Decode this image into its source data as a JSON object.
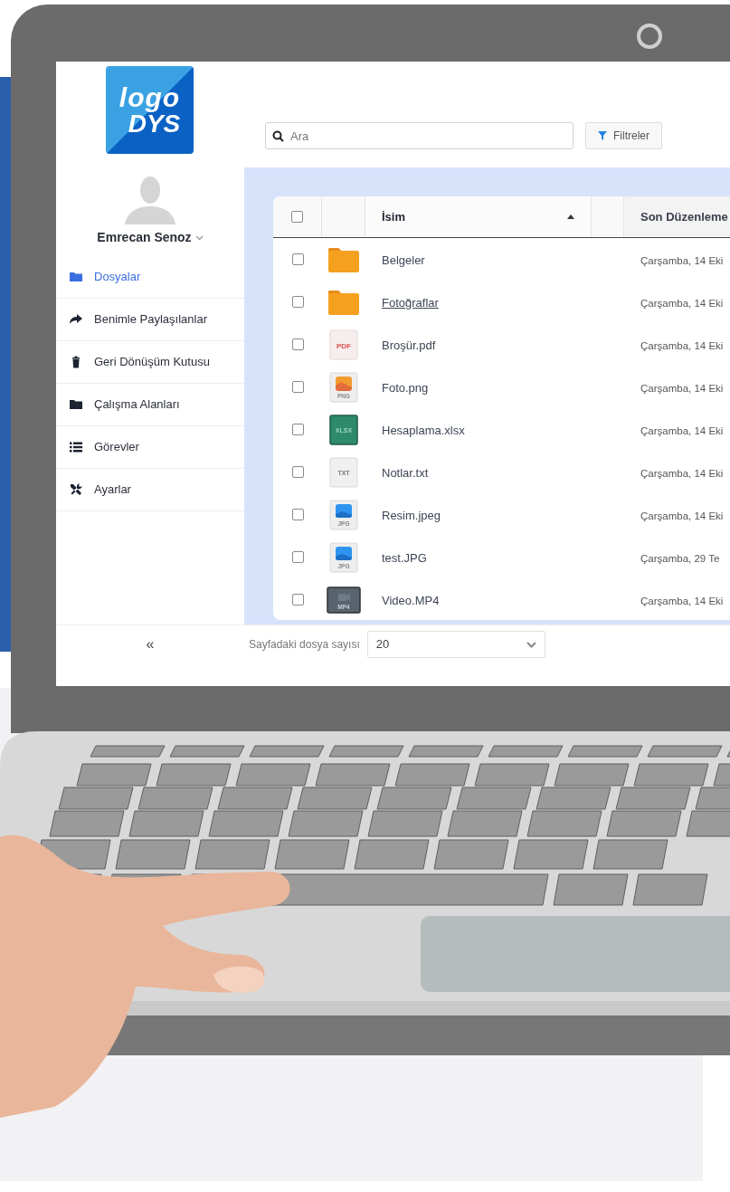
{
  "logo": {
    "top": "logo",
    "bottom": "DYS"
  },
  "user": {
    "name": "Emrecan Senoz"
  },
  "sidebar": {
    "items": [
      {
        "label": "Dosyalar",
        "kind": "folder",
        "selected": true
      },
      {
        "label": "Benimle Paylaşılanlar",
        "kind": "share",
        "selected": false
      },
      {
        "label": "Geri Dönüşüm Kutusu",
        "kind": "trash",
        "selected": false
      },
      {
        "label": "Çalışma Alanları",
        "kind": "folder",
        "selected": false
      },
      {
        "label": "Görevler",
        "kind": "list",
        "selected": false
      },
      {
        "label": "Ayarlar",
        "kind": "tools",
        "selected": false
      }
    ]
  },
  "search": {
    "placeholder": "Ara"
  },
  "filter_button": "Filtreler",
  "table": {
    "select_all": {
      "checked": false
    },
    "columns": [
      {
        "label": "İsim",
        "sorted_ascending": true
      },
      {
        "label": "Son Düzenleme",
        "sorted_ascending": false
      }
    ],
    "rows": [
      {
        "name": "Belgeler",
        "kind": "folder",
        "badge": "",
        "modified": "Çarşamba, 14 Eki",
        "checked": false,
        "hovered": false
      },
      {
        "name": "Fotoğraflar",
        "kind": "folder",
        "badge": "",
        "modified": "Çarşamba, 14 Eki",
        "checked": false,
        "hovered": true
      },
      {
        "name": "Broşür.pdf",
        "kind": "pdf",
        "badge": "PDF",
        "modified": "Çarşamba, 14 Eki",
        "checked": false,
        "hovered": false
      },
      {
        "name": "Foto.png",
        "kind": "image",
        "badge": "PNG",
        "modified": "Çarşamba, 14 Eki",
        "checked": false,
        "hovered": false
      },
      {
        "name": "Hesaplama.xlsx",
        "kind": "sheet",
        "badge": "XLSX",
        "modified": "Çarşamba, 14 Eki",
        "checked": false,
        "hovered": false
      },
      {
        "name": "Notlar.txt",
        "kind": "text",
        "badge": "TXT",
        "modified": "Çarşamba, 14 Eki",
        "checked": false,
        "hovered": false
      },
      {
        "name": "Resim.jpeg",
        "kind": "photo",
        "badge": "JPG",
        "modified": "Çarşamba, 14 Eki",
        "checked": false,
        "hovered": false
      },
      {
        "name": "test.JPG",
        "kind": "photo",
        "badge": "JPG",
        "modified": "Çarşamba, 29 Te",
        "checked": false,
        "hovered": false
      },
      {
        "name": "Video.MP4",
        "kind": "video",
        "badge": "MP4",
        "modified": "Çarşamba, 14 Eki",
        "checked": false,
        "hovered": false
      }
    ]
  },
  "footer": {
    "collapse": "«",
    "page_size_label": "Sayfadaki dosya sayısı",
    "page_size": "20"
  }
}
